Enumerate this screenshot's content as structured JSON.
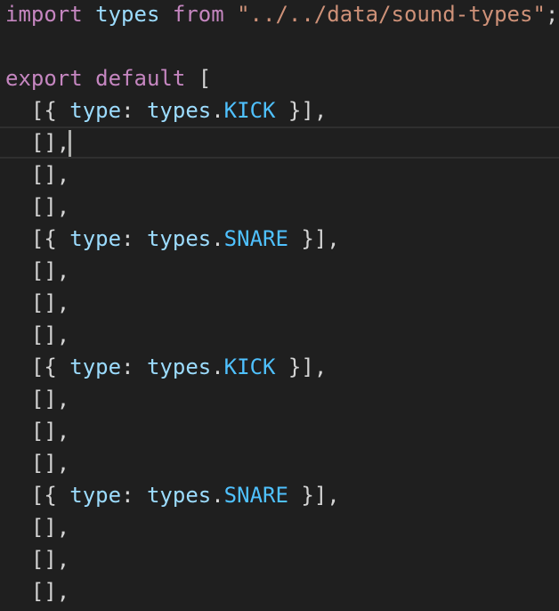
{
  "code": {
    "line1": {
      "import_kw": "import",
      "name": "types",
      "from_kw": "from",
      "path": "\"../../data/sound-types\"",
      "semi": ";"
    },
    "line3": {
      "export_kw": "export",
      "default_kw": "default",
      "open": "["
    },
    "rows": [
      {
        "sound": "KICK"
      },
      {},
      {},
      {},
      {
        "sound": "SNARE"
      },
      {},
      {},
      {},
      {
        "sound": "KICK"
      },
      {},
      {},
      {},
      {
        "sound": "SNARE"
      },
      {},
      {},
      {}
    ],
    "prop_key": "type",
    "obj_name": "types",
    "empty_row": "[],",
    "indent": "  "
  },
  "colors": {
    "background": "#1f1f1f",
    "keyword": "#c586c0",
    "identifier": "#9cdcfe",
    "string": "#ce9178",
    "constant": "#4fc1ff",
    "punctuation": "#d4d4d4"
  },
  "editor": {
    "cursor_row": 1
  }
}
